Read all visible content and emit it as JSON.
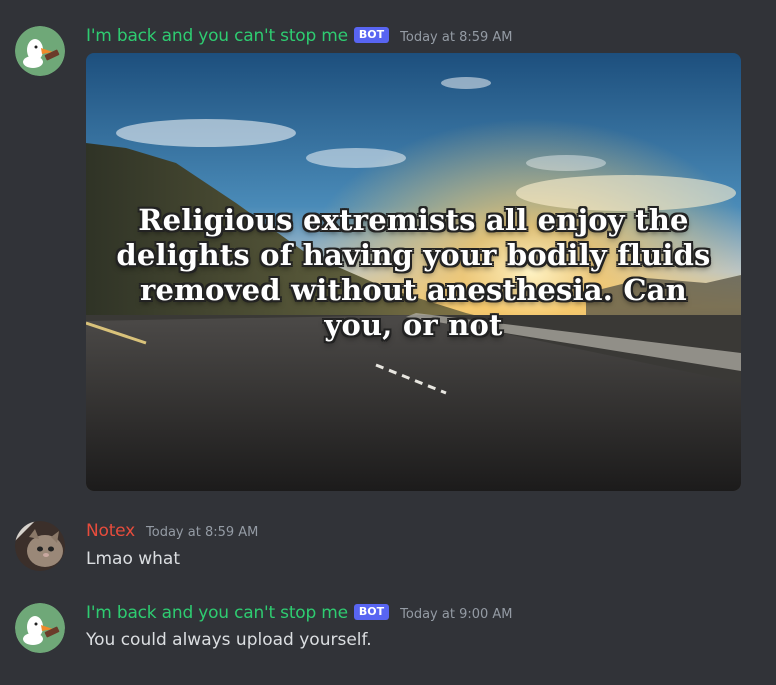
{
  "colors": {
    "background": "#313338",
    "bot_name": "#2ecc71",
    "user_name": "#e74c3c",
    "bot_tag": "#5865f2",
    "timestamp": "#949ba4",
    "message_text": "#dbdee1"
  },
  "messages": [
    {
      "username": "I'm back and you can't stop me",
      "bot_tag": "BOT",
      "timestamp": "Today at 8:59 AM",
      "avatar_icon": "goose-avatar-icon",
      "attachment": {
        "type": "image",
        "scene": "sunset-road-landscape",
        "caption": "Religious extremists all enjoy the delights of having your bodily fluids removed without anesthesia. Can you, or not"
      }
    },
    {
      "username": "Notex",
      "timestamp": "Today at 8:59 AM",
      "avatar_icon": "cat-avatar-icon",
      "text": "Lmao what"
    },
    {
      "username": "I'm back and you can't stop me",
      "bot_tag": "BOT",
      "timestamp": "Today at 9:00 AM",
      "avatar_icon": "goose-avatar-icon",
      "text": "You could always upload yourself."
    }
  ]
}
